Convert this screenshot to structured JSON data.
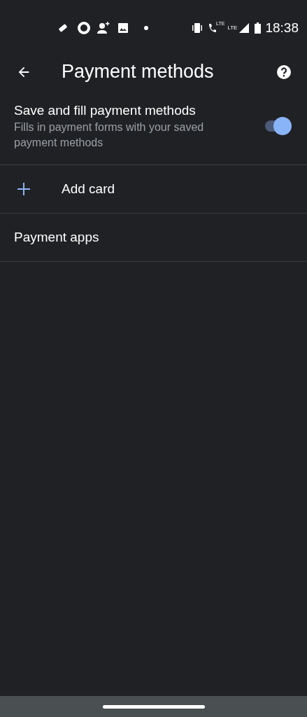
{
  "status_bar": {
    "call_label": "LTE",
    "network_label": "LTE",
    "time": "18:38"
  },
  "app_bar": {
    "title": "Payment methods"
  },
  "setting": {
    "title": "Save and fill payment methods",
    "description": "Fills in payment forms with your saved payment methods",
    "on": true
  },
  "items": [
    {
      "kind": "add",
      "label": "Add card"
    },
    {
      "kind": "plain",
      "label": "Payment apps"
    }
  ]
}
